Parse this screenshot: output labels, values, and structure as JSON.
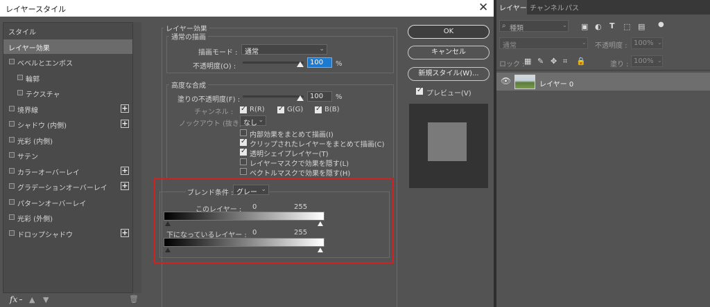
{
  "dialog": {
    "title": "レイヤースタイル",
    "close_icon": "close-icon",
    "styles_list": [
      {
        "label": "スタイル",
        "checkbox": false,
        "plus": false,
        "indent": 0,
        "selected": false
      },
      {
        "label": "レイヤー効果",
        "checkbox": false,
        "plus": false,
        "indent": 0,
        "selected": true
      },
      {
        "label": "ベベルとエンボス",
        "checkbox": true,
        "plus": false,
        "indent": 0,
        "selected": false
      },
      {
        "label": "輪郭",
        "checkbox": true,
        "plus": false,
        "indent": 1,
        "selected": false
      },
      {
        "label": "テクスチャ",
        "checkbox": true,
        "plus": false,
        "indent": 1,
        "selected": false
      },
      {
        "label": "境界線",
        "checkbox": true,
        "plus": true,
        "indent": 0,
        "selected": false
      },
      {
        "label": "シャドウ (内側)",
        "checkbox": true,
        "plus": true,
        "indent": 0,
        "selected": false
      },
      {
        "label": "光彩 (内側)",
        "checkbox": true,
        "plus": false,
        "indent": 0,
        "selected": false
      },
      {
        "label": "サテン",
        "checkbox": true,
        "plus": false,
        "indent": 0,
        "selected": false
      },
      {
        "label": "カラーオーバーレイ",
        "checkbox": true,
        "plus": true,
        "indent": 0,
        "selected": false
      },
      {
        "label": "グラデーションオーバーレイ",
        "checkbox": true,
        "plus": true,
        "indent": 0,
        "selected": false
      },
      {
        "label": "パターンオーバーレイ",
        "checkbox": true,
        "plus": false,
        "indent": 0,
        "selected": false
      },
      {
        "label": "光彩 (外側)",
        "checkbox": true,
        "plus": false,
        "indent": 0,
        "selected": false
      },
      {
        "label": "ドロップシャドウ",
        "checkbox": true,
        "plus": true,
        "indent": 0,
        "selected": false
      }
    ],
    "fx_label": "fx",
    "layer_effects": {
      "title": "レイヤー効果",
      "normal_blend": {
        "title": "通常の描画",
        "blend_mode_label": "描画モード :",
        "blend_mode_value": "通常",
        "opacity_label": "不透明度(O) :",
        "opacity_value": "100",
        "opacity_unit": "%",
        "opacity_level": 1.0
      },
      "advanced_blend": {
        "title": "高度な合成",
        "fill_opacity_label": "塗りの不透明度(F) :",
        "fill_opacity_value": "100",
        "fill_opacity_unit": "%",
        "fill_opacity_level": 1.0,
        "channels_label": "チャンネル :",
        "channels": [
          {
            "label": "R(R)",
            "checked": true
          },
          {
            "label": "G(G)",
            "checked": true
          },
          {
            "label": "B(B)",
            "checked": true
          }
        ],
        "knockout_label": "ノックアウト (抜き) :",
        "knockout_value": "なし",
        "options": [
          {
            "label": "内部効果をまとめて描画(I)",
            "checked": false
          },
          {
            "label": "クリップされたレイヤーをまとめて描画(C)",
            "checked": true
          },
          {
            "label": "透明シェイプレイヤー(T)",
            "checked": true
          },
          {
            "label": "レイヤーマスクで効果を隠す(L)",
            "checked": false
          },
          {
            "label": "ベクトルマスクで効果を隠す(H)",
            "checked": false
          }
        ]
      },
      "blend_if": {
        "label": "ブレンド条件 :",
        "value": "グレー",
        "this_layer_label": "このレイヤー :",
        "this_layer_min": "0",
        "this_layer_max": "255",
        "underlying_label": "下になっているレイヤー :",
        "underlying_min": "0",
        "underlying_max": "255"
      }
    },
    "buttons": {
      "ok": "OK",
      "cancel": "キャンセル",
      "new_style": "新規スタイル(W)...",
      "preview_label": "プレビュー(V)",
      "preview_checked": true
    }
  },
  "layers_panel": {
    "tabs": [
      "レイヤー",
      "チャンネル",
      "パス"
    ],
    "active_tab": 0,
    "filter_placeholder": "種類",
    "blend_mode": "通常",
    "opacity_label": "不透明度 :",
    "opacity_value": "100%",
    "lock_label": "ロック :",
    "fill_label": "塗り :",
    "fill_value": "100%",
    "layers": [
      {
        "name": "レイヤー 0",
        "visible": true,
        "selected": true
      }
    ]
  },
  "colors": {
    "highlight_frame": "#d52020",
    "selection_blue": "#1c7ad1"
  }
}
